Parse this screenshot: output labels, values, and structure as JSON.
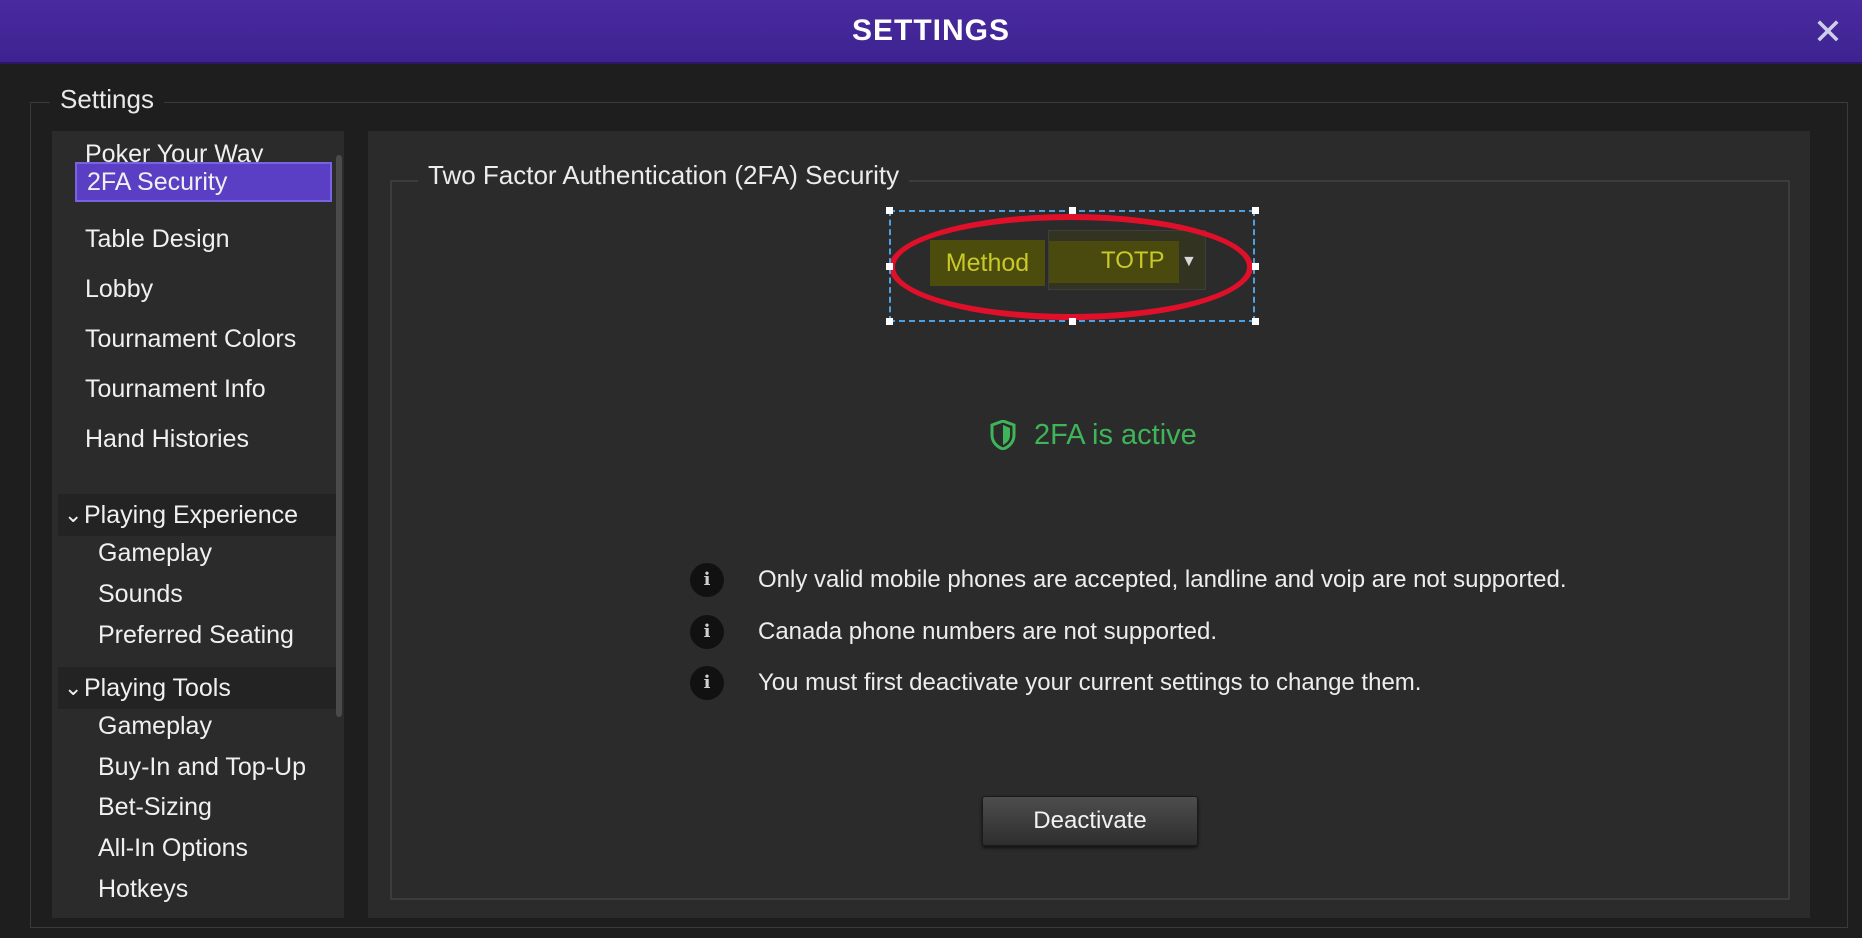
{
  "window": {
    "title": "SETTINGS",
    "close_symbol": "✕"
  },
  "settings_group": {
    "label": "Settings"
  },
  "sidebar": {
    "items": [
      {
        "label": "Poker Your Way"
      },
      {
        "label": "2FA Security",
        "active": true
      },
      {
        "label": "Table Design"
      },
      {
        "label": "Lobby"
      },
      {
        "label": "Tournament Colors"
      },
      {
        "label": "Tournament Info"
      },
      {
        "label": "Hand Histories"
      }
    ],
    "groups": [
      {
        "label": "Playing Experience",
        "expanded": true,
        "children": [
          {
            "label": "Gameplay"
          },
          {
            "label": "Sounds"
          },
          {
            "label": "Preferred Seating"
          }
        ]
      },
      {
        "label": "Playing Tools",
        "expanded": true,
        "children": [
          {
            "label": "Gameplay"
          },
          {
            "label": "Buy-In and Top-Up"
          },
          {
            "label": "Bet-Sizing"
          },
          {
            "label": "All-In Options"
          },
          {
            "label": "Hotkeys"
          }
        ]
      }
    ]
  },
  "tfa": {
    "section_title": "Two Factor Authentication (2FA) Security",
    "method_label": "Method",
    "method_value": "TOTP",
    "status_text": "2FA is active",
    "status_color": "#3eb559",
    "notes": [
      "Only valid mobile phones are accepted, landline and voip are not supported.",
      "Canada phone numbers are not supported.",
      "You must first deactivate your current settings to change them."
    ],
    "info_icon_symbol": "i",
    "deactivate_label": "Deactivate"
  },
  "colors": {
    "title_bar": "#4a2aa0",
    "active_nav": "#5a3fc4",
    "annotation_ellipse": "#e0102a",
    "highlight": "#c9c92a"
  },
  "icons": [
    "close-icon",
    "chevron-down-icon",
    "caret-down-icon",
    "shield-icon",
    "info-icon"
  ]
}
